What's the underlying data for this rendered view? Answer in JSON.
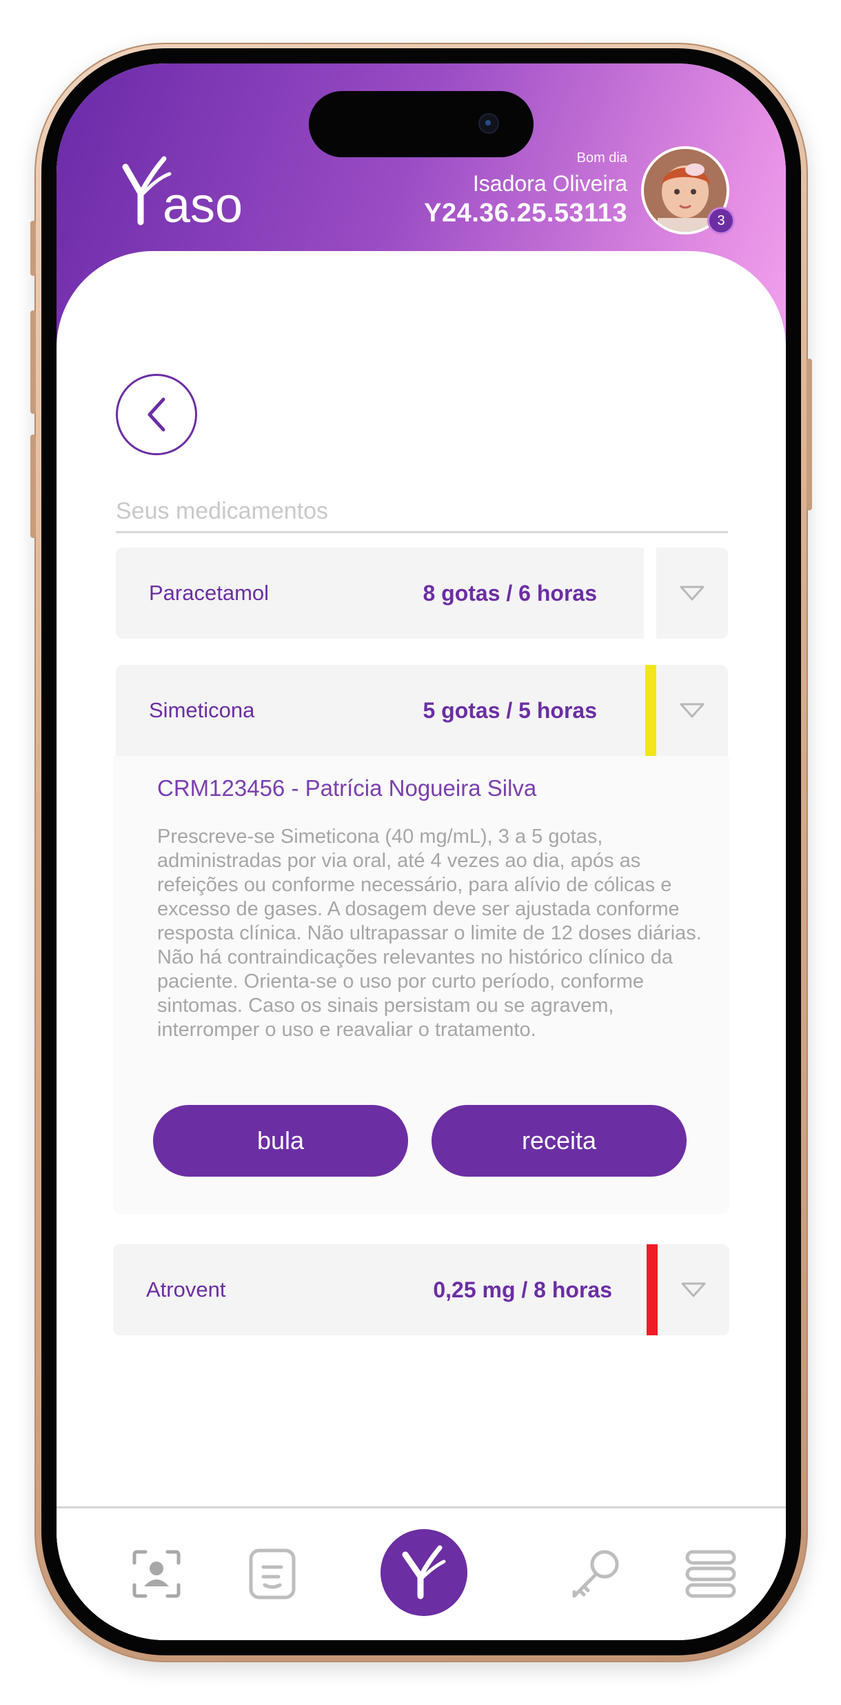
{
  "header": {
    "brand": "Yaso",
    "greeting": "Bom dia",
    "user_name": "Isadora Oliveira",
    "user_id": "Y24.36.25.53113",
    "notification_count": "3"
  },
  "section_title": "Seus medicamentos",
  "medications": [
    {
      "name": "Paracetamol",
      "dose": "8 gotas / 6 horas",
      "status_color": "#f4f4f4",
      "expanded": false
    },
    {
      "name": "Simeticona",
      "dose": "5 gotas / 5 horas",
      "status_color": "#f2e51c",
      "expanded": true
    },
    {
      "name": "Atrovent",
      "dose": "0,25 mg / 8 horas",
      "status_color": "#ef1c25",
      "expanded": false
    }
  ],
  "details": {
    "doctor": "CRM123456 - Patrícia Nogueira Silva",
    "prescription": "Prescreve-se Simeticona (40 mg/mL), 3 a 5 gotas, administradas por via oral, até 4 vezes ao dia, após as refeições ou conforme necessário, para alívio de cólicas e excesso de gases. A dosagem deve ser ajustada conforme resposta clínica. Não ultrapassar o limite de 12 doses diárias. Não há contraindicações relevantes no histórico clínico da paciente. Orienta-se o uso por curto período, conforme sintomas. Caso os sinais persistam ou se agravem, interromper o uso e reavaliar o tratamento.",
    "bula_label": "bula",
    "receita_label": "receita"
  },
  "nav": {
    "items": [
      "face-scan-icon",
      "document-icon",
      "yaso-home-icon",
      "key-icon",
      "menu-icon"
    ]
  },
  "colors": {
    "brand_purple": "#6b2ea3",
    "header_gradient_start": "#6a2aa8",
    "header_gradient_end": "#f5a6ef"
  }
}
